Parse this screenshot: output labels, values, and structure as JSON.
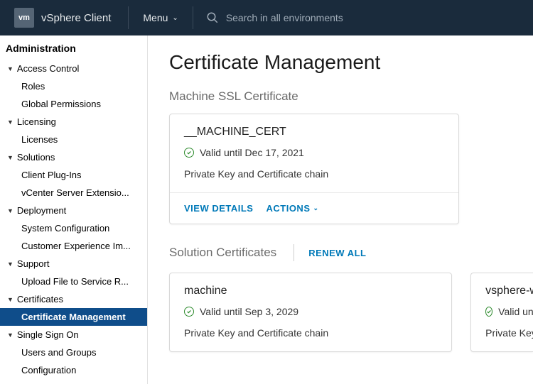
{
  "header": {
    "logo": "vm",
    "title": "vSphere Client",
    "menu": "Menu",
    "search_placeholder": "Search in all environments"
  },
  "sidebar": {
    "title": "Administration",
    "sections": [
      {
        "label": "Access Control",
        "items": [
          "Roles",
          "Global Permissions"
        ]
      },
      {
        "label": "Licensing",
        "items": [
          "Licenses"
        ]
      },
      {
        "label": "Solutions",
        "items": [
          "Client Plug-Ins",
          "vCenter Server Extensio..."
        ]
      },
      {
        "label": "Deployment",
        "items": [
          "System Configuration",
          "Customer Experience Im..."
        ]
      },
      {
        "label": "Support",
        "items": [
          "Upload File to Service R..."
        ]
      },
      {
        "label": "Certificates",
        "items": [
          "Certificate Management"
        ],
        "active_index": 0
      },
      {
        "label": "Single Sign On",
        "items": [
          "Users and Groups",
          "Configuration"
        ]
      }
    ]
  },
  "main": {
    "title": "Certificate Management",
    "ssl_section": "Machine SSL Certificate",
    "solution_section": "Solution Certificates",
    "renew_all": "RENEW ALL",
    "view_details": "VIEW DETAILS",
    "actions": "ACTIONS",
    "desc": "Private Key and Certificate chain",
    "ssl_cert": {
      "name": "__MACHINE_CERT",
      "valid": "Valid until Dec 17, 2021"
    },
    "sol_certs": [
      {
        "name": "machine",
        "valid": "Valid until Sep 3, 2029"
      },
      {
        "name": "vsphere-w",
        "valid": "Valid unti"
      }
    ]
  }
}
